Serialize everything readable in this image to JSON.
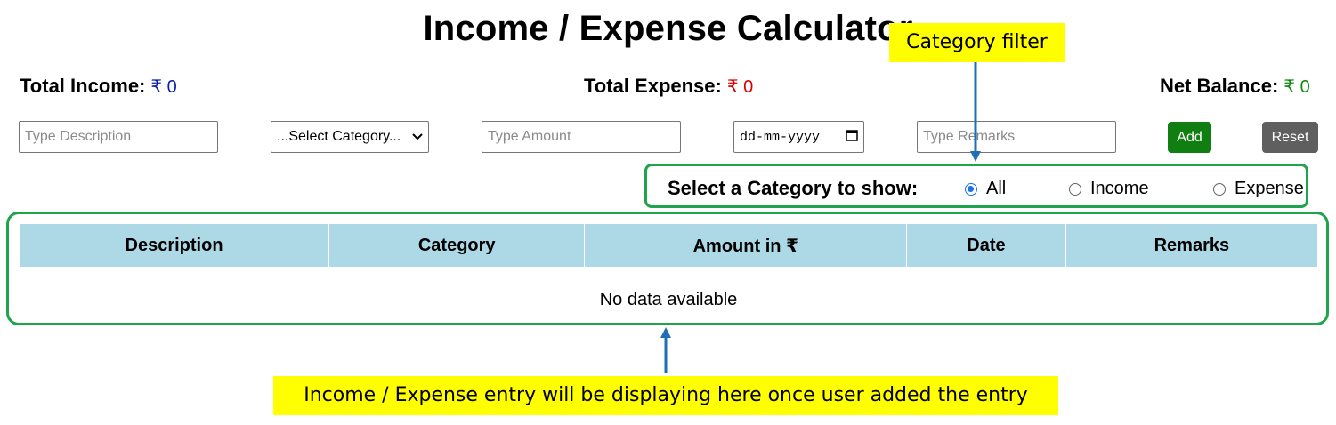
{
  "page": {
    "title": "Income / Expense Calculator"
  },
  "totals": {
    "income_label": "Total Income:",
    "income_value": "₹ 0",
    "expense_label": "Total Expense:",
    "expense_value": "₹ 0",
    "balance_label": "Net Balance:",
    "balance_value": "₹ 0"
  },
  "form": {
    "description_placeholder": "Type Description",
    "category_selected": "...Select Category...",
    "amount_placeholder": "Type Amount",
    "date_placeholder": "dd-mm-yyyy",
    "remarks_placeholder": "Type Remarks",
    "add_label": "Add",
    "reset_label": "Reset"
  },
  "filter": {
    "label": "Select a Category to show:",
    "options": [
      {
        "label": "All",
        "checked": true
      },
      {
        "label": "Income",
        "checked": false
      },
      {
        "label": "Expense",
        "checked": false
      }
    ]
  },
  "table": {
    "columns": [
      "Description",
      "Category",
      "Amount in ₹",
      "Date",
      "Remarks"
    ],
    "empty_message": "No data available"
  },
  "annotations": {
    "category_filter": "Category filter",
    "entry_note": "Income / Expense entry will be displaying here once user added the entry"
  },
  "colors": {
    "income": "#0b1fa8",
    "expense": "#d90000",
    "balance": "#0a8a0a",
    "add_button": "#117e11",
    "reset_button": "#5f5f5f",
    "table_header": "#add8e6",
    "highlight_border": "#1fa34b",
    "callout_bg": "#ffff00",
    "arrow": "#1f6fb5"
  },
  "icons": {
    "date_picker": "calendar-icon",
    "select": "chevron-down-icon"
  }
}
